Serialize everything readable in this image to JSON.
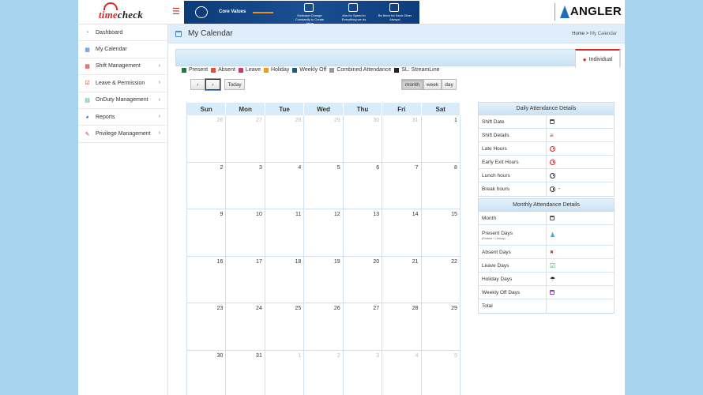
{
  "header": {
    "logo_text_red": "time",
    "logo_text_dark": "check",
    "banner": {
      "title": "Core Values",
      "values": [
        "Embrace Change Constantly to Create Value",
        "Aim for Speed in Everything we do",
        "Be there for Each Other Always!"
      ]
    },
    "brand_name": "ANGLER"
  },
  "sidebar": {
    "items": [
      {
        "label": "Dashboard",
        "icon": "dashboard-icon",
        "color": "#3a7bd5",
        "has_children": false
      },
      {
        "label": "My Calendar",
        "icon": "calendar-icon",
        "color": "#3a7bd5",
        "has_children": false
      },
      {
        "label": "Shift Management",
        "icon": "shift-icon",
        "color": "#d62828",
        "has_children": true
      },
      {
        "label": "Leave & Permission",
        "icon": "leave-icon",
        "color": "#c0392b",
        "has_children": true
      },
      {
        "label": "OnDuty Management",
        "icon": "onduty-icon",
        "color": "#27ae60",
        "has_children": true
      },
      {
        "label": "Reports",
        "icon": "reports-icon",
        "color": "#2c6fb5",
        "has_children": true
      },
      {
        "label": "Privilege Management",
        "icon": "wrench-icon",
        "color": "#c0392b",
        "has_children": true
      }
    ]
  },
  "page": {
    "title": "My Calendar",
    "breadcrumb_home": "Home",
    "breadcrumb_sep": ">",
    "breadcrumb_current": "My Calendar"
  },
  "tabs": {
    "individual": "Individual"
  },
  "legend": [
    {
      "label": "Present",
      "color": "#1e7d3a"
    },
    {
      "label": "Absent",
      "color": "#e74c3c"
    },
    {
      "label": "Leave",
      "color": "#d6336c"
    },
    {
      "label": "Holiday",
      "color": "#f39c12"
    },
    {
      "label": "Weekly Off",
      "color": "#1a5f7a"
    },
    {
      "label": "Combined Attendance",
      "color": "#999999"
    },
    {
      "label": "SL: StreamLine",
      "color": "#222222"
    }
  ],
  "toolbar": {
    "prev": "‹",
    "next": "›",
    "today": "Today",
    "views": [
      "month",
      "week",
      "day"
    ],
    "active_view": "month"
  },
  "calendar": {
    "weekdays": [
      "Sun",
      "Mon",
      "Tue",
      "Wed",
      "Thu",
      "Fri",
      "Sat"
    ],
    "weeks": [
      [
        {
          "d": "26",
          "o": true
        },
        {
          "d": "27",
          "o": true
        },
        {
          "d": "28",
          "o": true
        },
        {
          "d": "29",
          "o": true
        },
        {
          "d": "30",
          "o": true
        },
        {
          "d": "31",
          "o": true
        },
        {
          "d": "1",
          "o": false
        }
      ],
      [
        {
          "d": "2",
          "o": false
        },
        {
          "d": "3",
          "o": false
        },
        {
          "d": "4",
          "o": false
        },
        {
          "d": "5",
          "o": false
        },
        {
          "d": "6",
          "o": false
        },
        {
          "d": "7",
          "o": false
        },
        {
          "d": "8",
          "o": false
        }
      ],
      [
        {
          "d": "9",
          "o": false
        },
        {
          "d": "10",
          "o": false
        },
        {
          "d": "11",
          "o": false
        },
        {
          "d": "12",
          "o": false
        },
        {
          "d": "13",
          "o": false
        },
        {
          "d": "14",
          "o": false
        },
        {
          "d": "15",
          "o": false
        }
      ],
      [
        {
          "d": "16",
          "o": false
        },
        {
          "d": "17",
          "o": false
        },
        {
          "d": "18",
          "o": false
        },
        {
          "d": "19",
          "o": false
        },
        {
          "d": "20",
          "o": false
        },
        {
          "d": "21",
          "o": false
        },
        {
          "d": "22",
          "o": false
        }
      ],
      [
        {
          "d": "23",
          "o": false
        },
        {
          "d": "24",
          "o": false
        },
        {
          "d": "25",
          "o": false
        },
        {
          "d": "26",
          "o": false
        },
        {
          "d": "27",
          "o": false
        },
        {
          "d": "28",
          "o": false
        },
        {
          "d": "29",
          "o": false
        }
      ],
      [
        {
          "d": "30",
          "o": false
        },
        {
          "d": "31",
          "o": false
        },
        {
          "d": "1",
          "o": true
        },
        {
          "d": "2",
          "o": true
        },
        {
          "d": "3",
          "o": true
        },
        {
          "d": "4",
          "o": true
        },
        {
          "d": "5",
          "o": true
        }
      ]
    ]
  },
  "daily_panel": {
    "title": "Daily Attendance Details",
    "rows": [
      {
        "label": "Shift Date",
        "icon": "calendar-icon",
        "value": ""
      },
      {
        "label": "Shift Details",
        "icon": "list-icon",
        "value": ""
      },
      {
        "label": "Late Hours",
        "icon": "clock-red-icon",
        "value": ""
      },
      {
        "label": "Early Exit Hours",
        "icon": "clock-red-icon",
        "value": ""
      },
      {
        "label": "Lunch hours",
        "icon": "clock-icon",
        "value": ""
      },
      {
        "label": "Break hours",
        "icon": "clock-icon",
        "value": "-"
      }
    ]
  },
  "monthly_panel": {
    "title": "Monthly Attendance Details",
    "rows": [
      {
        "label": "Month",
        "sub": "",
        "icon": "calendar-icon",
        "value": ""
      },
      {
        "label": "Present Days",
        "sub": "(Present + Onduty)",
        "icon": "person-icon",
        "value": ""
      },
      {
        "label": "Absent Days",
        "sub": "",
        "icon": "cross-icon",
        "value": ""
      },
      {
        "label": "Leave Days",
        "sub": "",
        "icon": "check-icon",
        "value": ""
      },
      {
        "label": "Holiday Days",
        "sub": "",
        "icon": "umbrella-icon",
        "value": ""
      },
      {
        "label": "Weekly Off Days",
        "sub": "",
        "icon": "calendar-purple-icon",
        "value": ""
      },
      {
        "label": "Total",
        "sub": "",
        "icon": "",
        "value": ""
      }
    ]
  }
}
